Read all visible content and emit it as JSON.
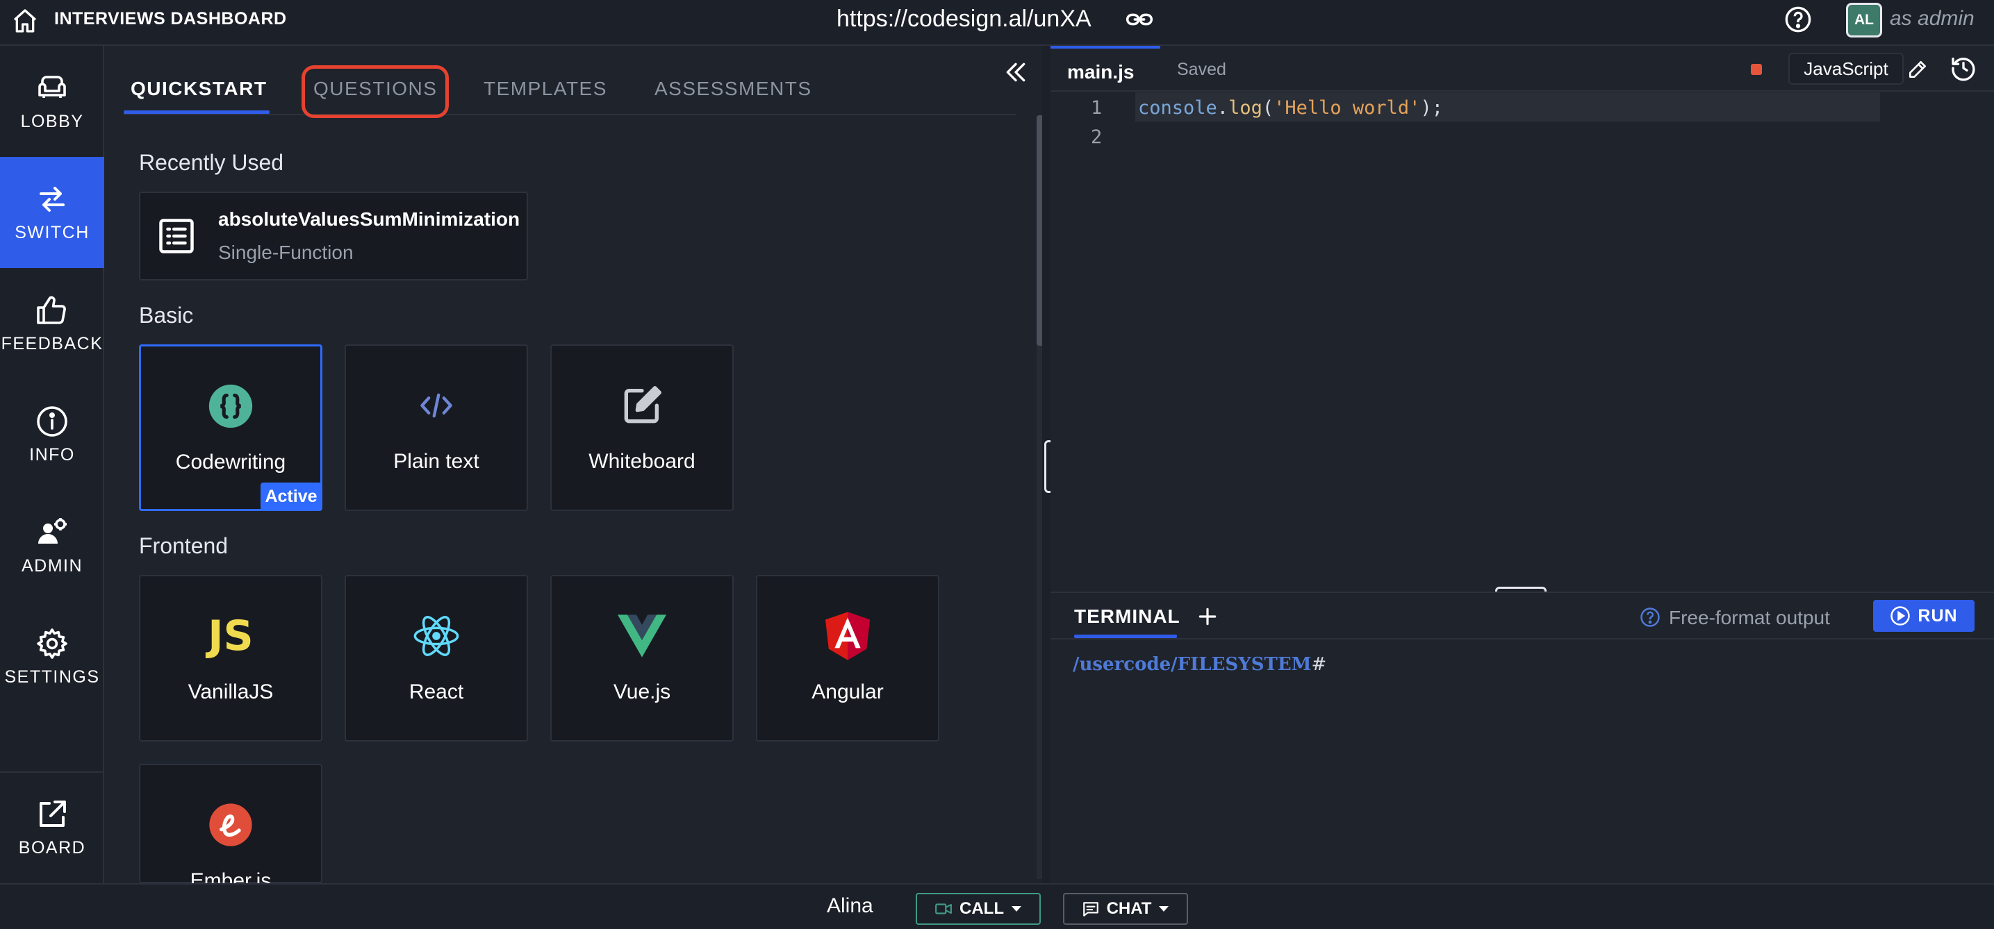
{
  "header": {
    "title": "INTERVIEWS DASHBOARD",
    "url": "https://codesign.al/unXA",
    "avatar_initials": "AL",
    "role": "as admin"
  },
  "sidebar": {
    "items": [
      {
        "label": "LOBBY",
        "icon": "sofa-icon"
      },
      {
        "label": "SWITCH",
        "icon": "switch-arrows-icon",
        "active": true
      },
      {
        "label": "FEEDBACK",
        "icon": "thumbs-up-icon"
      },
      {
        "label": "INFO",
        "icon": "info-icon"
      },
      {
        "label": "ADMIN",
        "icon": "admin-gear-user-icon"
      },
      {
        "label": "SETTINGS",
        "icon": "gear-icon"
      }
    ],
    "board": {
      "label": "BOARD",
      "icon": "external-link-icon"
    }
  },
  "tabs": {
    "quickstart": "QUICKSTART",
    "questions": "QUESTIONS",
    "templates": "TEMPLATES",
    "assessments": "ASSESSMENTS"
  },
  "sections": {
    "recent": "Recently Used",
    "basic": "Basic",
    "frontend": "Frontend"
  },
  "recent": {
    "title": "absoluteValuesSumMinimization",
    "subtitle": "Single-Function"
  },
  "basic_cards": {
    "codewriting": "Codewriting",
    "plaintext": "Plain text",
    "whiteboard": "Whiteboard",
    "active_badge": "Active"
  },
  "frontend_cards": {
    "vanilla": "VanillaJS",
    "react": "React",
    "vue": "Vue.js",
    "angular": "Angular",
    "ember": "Ember.js"
  },
  "editor": {
    "file_name": "main.js",
    "save_status": "Saved",
    "language": "JavaScript",
    "line_numbers": [
      "1",
      "2"
    ],
    "code_tokens": {
      "obj": "console",
      "dot": ".",
      "fn": "log",
      "open": "(",
      "str": "'Hello world'",
      "close": ");"
    }
  },
  "terminal": {
    "tab": "TERMINAL",
    "free_format": "Free-format output",
    "run_label": "RUN",
    "prompt_path": "/usercode/FILESYSTEM",
    "prompt_symbol": "#"
  },
  "bottom": {
    "user": "Alina",
    "call": "CALL",
    "chat": "CHAT"
  },
  "colors": {
    "accent": "#2f5ce8",
    "highlight": "#e5432f",
    "background": "#1f232c"
  }
}
